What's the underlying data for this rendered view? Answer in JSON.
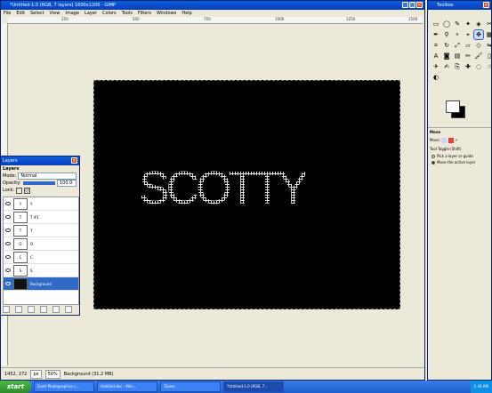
{
  "window": {
    "title": "*Untitled-1.0 (RGB, 7 layers) 1600x1200 - GIMP",
    "menu": [
      "File",
      "Edit",
      "Select",
      "View",
      "Image",
      "Layer",
      "Colors",
      "Tools",
      "Filters",
      "Windows",
      "Help"
    ]
  },
  "ruler_h": [
    "250",
    "500",
    "750",
    "1000",
    "1250",
    "1500"
  ],
  "canvas": {
    "text": "SCOTTY"
  },
  "status": {
    "coords": "1452, 272",
    "unit": "px",
    "zoom": "50%",
    "info": "Background (31.2 MB)"
  },
  "layers": {
    "title": "Layers",
    "tab": "Layers",
    "mode_label": "Mode:",
    "mode_value": "Normal",
    "opacity_label": "Opacity:",
    "opacity_value": "100.0",
    "lock_label": "Lock:",
    "items": [
      {
        "name": "Y",
        "thumb": "Y"
      },
      {
        "name": "T #1",
        "thumb": "T"
      },
      {
        "name": "T",
        "thumb": "T"
      },
      {
        "name": "O",
        "thumb": "O"
      },
      {
        "name": "C",
        "thumb": "C"
      },
      {
        "name": "S",
        "thumb": "S"
      },
      {
        "name": "Background",
        "thumb": ""
      }
    ]
  },
  "toolbox": {
    "title": "Toolbox",
    "tool_options_title": "Move",
    "move_label": "Move:",
    "tool_toggle": "Tool Toggle (Shift)",
    "option1": "Pick a layer or guide",
    "option2": "Move the active layer"
  },
  "taskbar": {
    "start": "start",
    "tasks": [
      "Scott Photographics (...",
      "Untitled.doc - Micr...",
      "iTunes",
      "*Untitled-1.0 (RGB, 7..."
    ],
    "time": "1:44 AM"
  },
  "colors": {
    "accent": "#316ac5",
    "titlebar": "#0b5ce0"
  }
}
